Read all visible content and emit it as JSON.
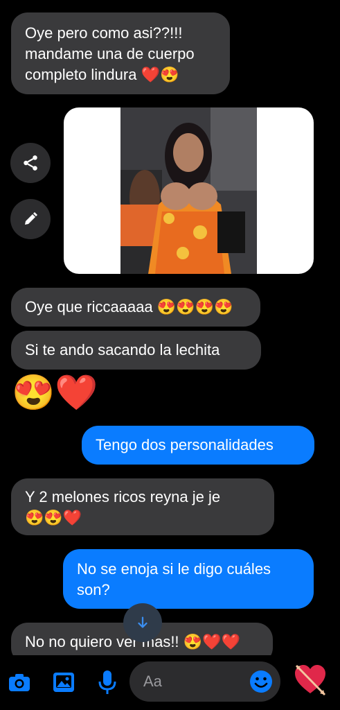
{
  "messages": {
    "m1": {
      "text": "Oye pero como asi??!!!\nmandame una de cuerpo\ncompleto lindura",
      "emoji": "❤️😍"
    },
    "m2": {
      "text": "Oye que riccaaaaa",
      "emoji": "😍😍😍😍"
    },
    "m3": {
      "text": "Si te ando sacando la lechita"
    },
    "m4": {
      "emoji": "😍❤️"
    },
    "m5": {
      "text": "Tengo dos personalidades"
    },
    "m6": {
      "text": "Y 2 melones ricos reyna je je",
      "emoji": "😍😍❤️"
    },
    "m7": {
      "text": "No se enoja si le digo cuáles\nson?"
    },
    "m8": {
      "text": "No no quiero ver mas!!",
      "emoji": "😍❤️❤️"
    }
  },
  "composer": {
    "placeholder": "Aa"
  },
  "icons": {
    "share": "share-icon",
    "edit": "pencil-icon",
    "scroll_down": "arrow-down-icon",
    "camera": "camera-icon",
    "gallery": "image-icon",
    "mic": "microphone-icon",
    "emoji": "smiley-icon",
    "quick_reaction": "heart-arrow-icon"
  },
  "colors": {
    "incoming": "#3a3a3c",
    "outgoing": "#0a7cff",
    "accent": "#0a7cff"
  }
}
